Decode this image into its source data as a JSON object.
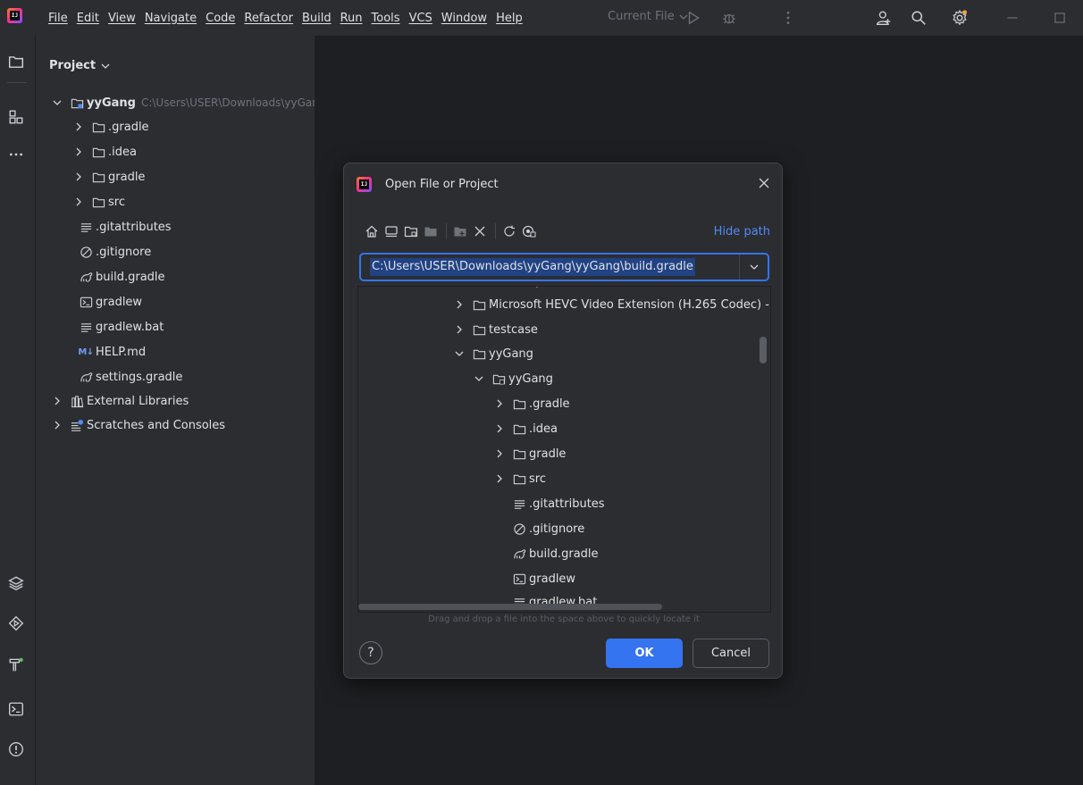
{
  "menu": [
    "File",
    "Edit",
    "View",
    "Navigate",
    "Code",
    "Refactor",
    "Build",
    "Run",
    "Tools",
    "VCS",
    "Window",
    "Help"
  ],
  "run_config": "Current File",
  "project_panel": {
    "title": "Project",
    "root": {
      "name": "yyGang",
      "path": "C:\\Users\\USER\\Downloads\\yyGang"
    },
    "items": [
      {
        "label": ".gradle",
        "icon": "folder-icon"
      },
      {
        "label": ".idea",
        "icon": "folder-icon"
      },
      {
        "label": "gradle",
        "icon": "folder-icon"
      },
      {
        "label": "src",
        "icon": "folder-icon"
      },
      {
        "label": ".gitattributes",
        "icon": "text-file-icon"
      },
      {
        "label": ".gitignore",
        "icon": "ignore-file-icon"
      },
      {
        "label": "build.gradle",
        "icon": "gradle-icon"
      },
      {
        "label": "gradlew",
        "icon": "terminal-file-icon"
      },
      {
        "label": "gradlew.bat",
        "icon": "text-file-icon"
      },
      {
        "label": "HELP.md",
        "icon": "markdown-icon"
      },
      {
        "label": "settings.gradle",
        "icon": "gradle-icon"
      },
      {
        "label": "External Libraries",
        "icon": "libraries-icon"
      },
      {
        "label": "Scratches and Consoles",
        "icon": "scratches-icon"
      }
    ],
    "md_badge": "M↓"
  },
  "dialog": {
    "title": "Open File or Project",
    "hide_path": "Hide path",
    "path_value": "C:\\Users\\USER\\Downloads\\yyGang\\yyGang\\build.gradle",
    "tree": [
      {
        "label": "Microsoft HEVC Video Extension (H.265 Codec) -",
        "icon": "folder-icon"
      },
      {
        "label": "testcase",
        "icon": "folder-icon"
      },
      {
        "label": "yyGang",
        "icon": "folder-icon"
      },
      {
        "label": "yyGang",
        "icon": "module-folder-icon"
      },
      {
        "label": ".gradle",
        "icon": "folder-icon"
      },
      {
        "label": ".idea",
        "icon": "folder-icon"
      },
      {
        "label": "gradle",
        "icon": "folder-icon"
      },
      {
        "label": "src",
        "icon": "folder-icon"
      },
      {
        "label": ".gitattributes",
        "icon": "text-file-icon"
      },
      {
        "label": ".gitignore",
        "icon": "ignore-file-icon"
      },
      {
        "label": "build.gradle",
        "icon": "gradle-icon"
      },
      {
        "label": "gradlew",
        "icon": "terminal-file-icon"
      },
      {
        "label": "gradlew.bat",
        "icon": "text-file-icon"
      }
    ],
    "drag_hint": "Drag and drop a file into the space above to quickly locate it",
    "help_label": "?",
    "ok_label": "OK",
    "cancel_label": "Cancel"
  }
}
